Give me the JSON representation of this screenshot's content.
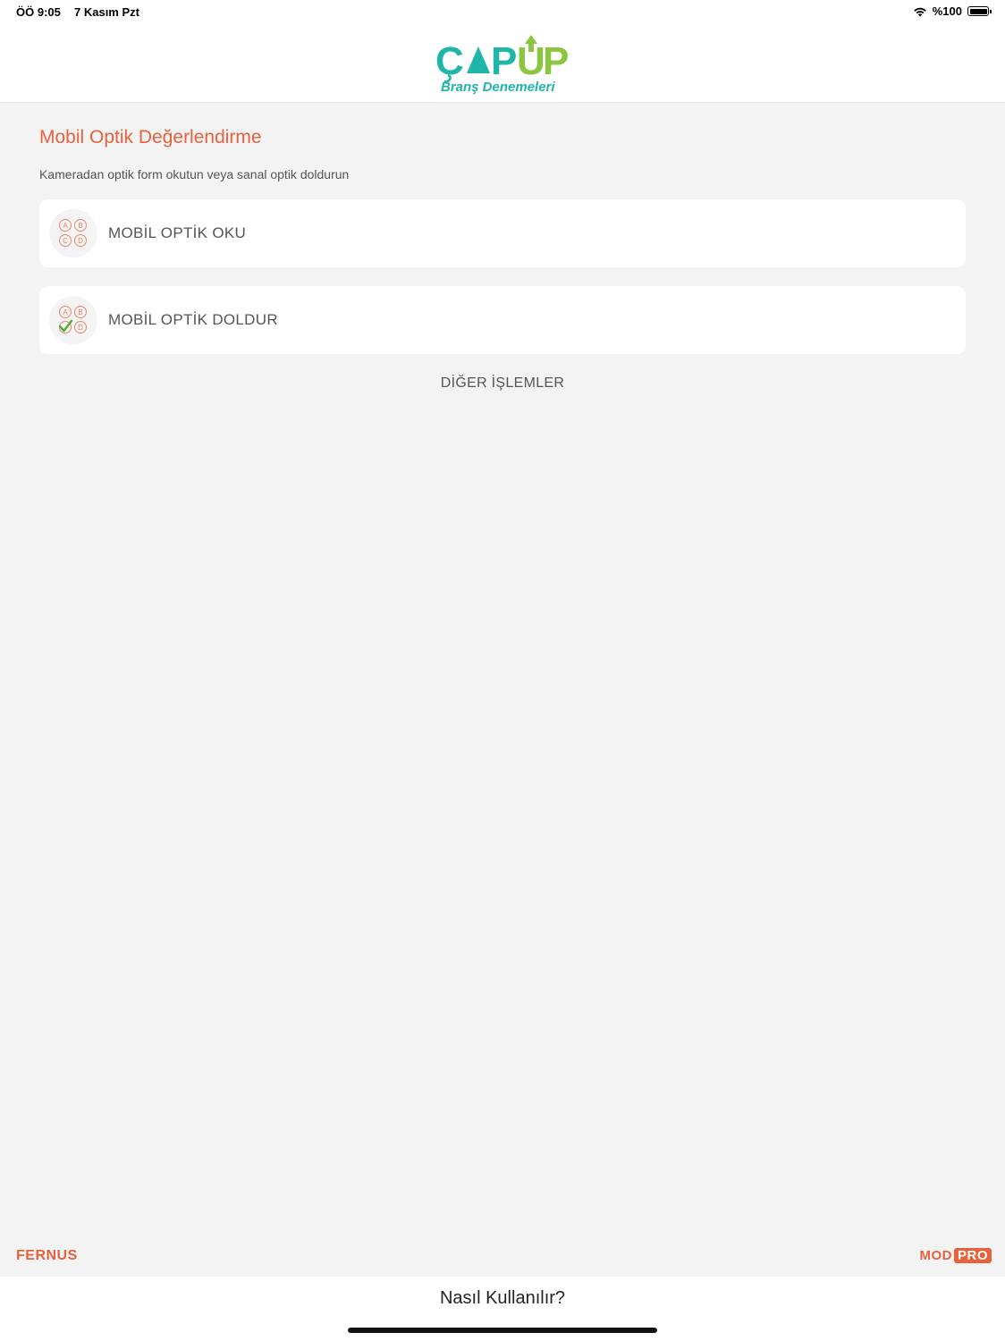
{
  "status_bar": {
    "time": "ÖÖ 9:05",
    "date": "7 Kasım Pzt",
    "battery": "%100"
  },
  "header": {
    "logo_text": "ÇAPUP",
    "logo_subtitle": "Branş Denemeleri",
    "logo_colors": {
      "teal": "#1fb5a8",
      "green": "#8cc63f"
    }
  },
  "main": {
    "title": "Mobil Optik Değerlendirme",
    "subtitle": "Kameradan optik form okutun veya sanal optik doldurun",
    "cards": [
      {
        "label": "MOBİL OPTİK OKU",
        "icon": "abcd-bubbles-icon"
      },
      {
        "label": "MOBİL OPTİK DOLDUR",
        "icon": "abcd-checked-bubbles-icon"
      }
    ],
    "other_actions": "DİĞER İŞLEMLER"
  },
  "footer": {
    "brand_left": "FERNUS",
    "brand_right_mod": "MOD",
    "brand_right_pro": "PRO",
    "help": "Nasıl Kullanılır?"
  },
  "colors": {
    "accent": "#e8613c",
    "background": "#f3f3f3",
    "card": "#ffffff",
    "text": "#555555"
  }
}
